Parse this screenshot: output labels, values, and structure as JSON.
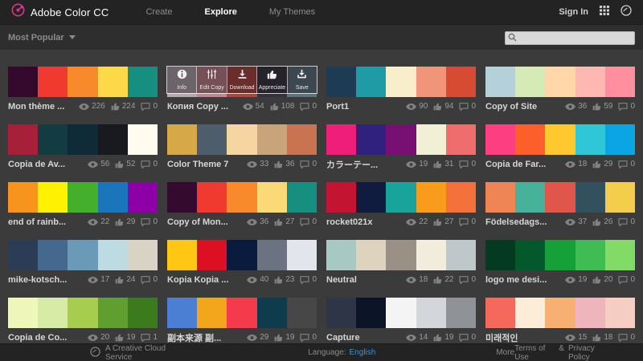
{
  "header": {
    "brand": "Adobe Color CC",
    "tabs": [
      {
        "label": "Create",
        "active": false
      },
      {
        "label": "Explore",
        "active": true
      },
      {
        "label": "My Themes",
        "active": false
      }
    ],
    "sign_in": "Sign In"
  },
  "filter_bar": {
    "sort_label": "Most Popular",
    "search_placeholder": ""
  },
  "overlay_actions": [
    {
      "label": "Info",
      "icon": "info-icon"
    },
    {
      "label": "Edit Copy",
      "icon": "edit-copy-icon"
    },
    {
      "label": "Download",
      "icon": "download-icon"
    },
    {
      "label": "Appreciate",
      "icon": "appreciate-icon"
    },
    {
      "label": "Save",
      "icon": "save-icon"
    }
  ],
  "themes": [
    {
      "name": "Mon thème ...",
      "colors": [
        "#34092d",
        "#f0392f",
        "#f98a2b",
        "#fbd949",
        "#178f80"
      ],
      "views": 226,
      "likes": 224,
      "comments": 0,
      "overlay": false
    },
    {
      "name": "Копия Copy ...",
      "colors": [
        "#b3a9ae",
        "#c4868e",
        "#b0443f",
        "#33333b",
        "#5d7380"
      ],
      "views": 54,
      "likes": 108,
      "comments": 0,
      "overlay": true
    },
    {
      "name": "Port1",
      "colors": [
        "#1d3c54",
        "#1f9ba6",
        "#f8eecb",
        "#f09579",
        "#d84b33"
      ],
      "views": 90,
      "likes": 94,
      "comments": 0,
      "overlay": false
    },
    {
      "name": "Copy of Site",
      "colors": [
        "#b4d0d8",
        "#d6eab6",
        "#ffd7a8",
        "#ffb7b2",
        "#ff8e9e"
      ],
      "views": 36,
      "likes": 59,
      "comments": 0,
      "overlay": false
    },
    {
      "name": "Copia de Av...",
      "colors": [
        "#a62039",
        "#123c41",
        "#0f2b38",
        "#191920",
        "#fffbee"
      ],
      "views": 56,
      "likes": 52,
      "comments": 0,
      "overlay": false
    },
    {
      "name": "Color Theme 7",
      "colors": [
        "#d6a847",
        "#4e5d6c",
        "#f6d5a2",
        "#c9a379",
        "#c97450"
      ],
      "views": 33,
      "likes": 36,
      "comments": 0,
      "overlay": false
    },
    {
      "name": "カラーテー...",
      "colors": [
        "#ef1e79",
        "#31217e",
        "#770f75",
        "#f1efd6",
        "#f06d6d"
      ],
      "views": 19,
      "likes": 31,
      "comments": 0,
      "overlay": false
    },
    {
      "name": "Copia de Far...",
      "colors": [
        "#fd3e81",
        "#fd5f2b",
        "#ffc82e",
        "#2fc6d8",
        "#0aa5e2"
      ],
      "views": 18,
      "likes": 29,
      "comments": 0,
      "overlay": false
    },
    {
      "name": "end of rainb...",
      "colors": [
        "#f7941e",
        "#fff200",
        "#44af2a",
        "#1b75bb",
        "#8d00a8"
      ],
      "views": 22,
      "likes": 29,
      "comments": 0,
      "overlay": false
    },
    {
      "name": "Copy of Mon...",
      "colors": [
        "#340a2e",
        "#f0392f",
        "#f98a2b",
        "#fbd977",
        "#178f80"
      ],
      "views": 36,
      "likes": 27,
      "comments": 0,
      "overlay": false
    },
    {
      "name": "rocket021x",
      "colors": [
        "#c31432",
        "#101b40",
        "#18a39b",
        "#f99c1b",
        "#f4713c"
      ],
      "views": 22,
      "likes": 27,
      "comments": 0,
      "overlay": false
    },
    {
      "name": "Födelsedags...",
      "colors": [
        "#ef8454",
        "#46b29a",
        "#e0564b",
        "#33505f",
        "#f2ce4b"
      ],
      "views": 37,
      "likes": 26,
      "comments": 0,
      "overlay": false
    },
    {
      "name": "mike-kotsch...",
      "colors": [
        "#2c3c57",
        "#45688e",
        "#6b9ab8",
        "#bcdbe2",
        "#d9d3c6"
      ],
      "views": 17,
      "likes": 24,
      "comments": 0,
      "overlay": false
    },
    {
      "name": "Kopia Kopia ...",
      "colors": [
        "#ffc613",
        "#dc0f23",
        "#0b1b3d",
        "#6b7282",
        "#e2e5ec"
      ],
      "views": 40,
      "likes": 23,
      "comments": 0,
      "overlay": false
    },
    {
      "name": "Neutral",
      "colors": [
        "#a8c8c4",
        "#ded3be",
        "#9b9086",
        "#f1ecdb",
        "#bec7c9"
      ],
      "views": 18,
      "likes": 22,
      "comments": 0,
      "overlay": false
    },
    {
      "name": "logo me desi...",
      "colors": [
        "#043b20",
        "#03592b",
        "#16a138",
        "#3fbd52",
        "#83db67"
      ],
      "views": 19,
      "likes": 20,
      "comments": 0,
      "overlay": false
    },
    {
      "name": "Copia de Co...",
      "colors": [
        "#eef6b9",
        "#d7eba4",
        "#a6cd4e",
        "#5f9e2f",
        "#3c7a1e"
      ],
      "views": 20,
      "likes": 19,
      "comments": 1,
      "overlay": false
    },
    {
      "name": "副本来源 副...",
      "colors": [
        "#4a7fd4",
        "#f2a61c",
        "#f43b4c",
        "#0e3c4c",
        "#474747"
      ],
      "views": 29,
      "likes": 19,
      "comments": 0,
      "overlay": false
    },
    {
      "name": "Capture",
      "colors": [
        "#2e3547",
        "#0c1527",
        "#f4f4f4",
        "#d3d6db",
        "#8f9296"
      ],
      "views": 14,
      "likes": 19,
      "comments": 0,
      "overlay": false
    },
    {
      "name": "미래적인",
      "colors": [
        "#f4695c",
        "#fcecd8",
        "#f8b072",
        "#eeb5bc",
        "#f6cdc2"
      ],
      "views": 15,
      "likes": 18,
      "comments": 0,
      "overlay": false
    }
  ],
  "footer": {
    "service": "A Creative Cloud Service",
    "language_label": "Language:",
    "language_value": "English",
    "more": "More",
    "terms": "Terms of Use",
    "separator": "&",
    "privacy": "Privacy Policy"
  },
  "colors": {
    "accent_magenta": "#e5308a",
    "link_blue": "#2997e8",
    "header_bg": "#232323",
    "filter_bg": "#2e2e2e",
    "main_bg": "#3b3b3b",
    "footer_bg": "#232323"
  }
}
